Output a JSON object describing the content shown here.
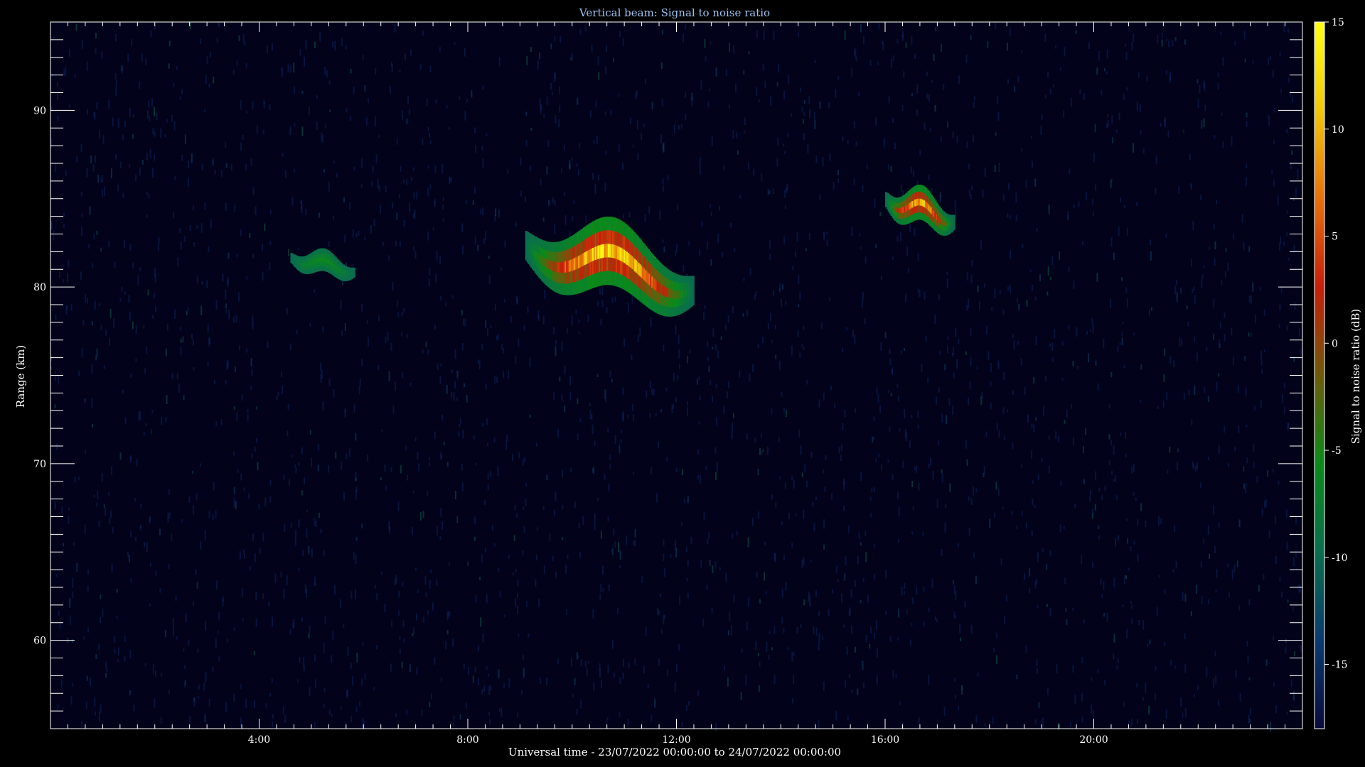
{
  "chart_data": {
    "type": "heatmap",
    "title": "Vertical beam: Signal to noise ratio",
    "xlabel": "Universal time - 23/07/2022 00:00:00 to 24/07/2022 00:00:00",
    "ylabel": "Range (km)",
    "colorbar_label": "Signal to noise ratio (dB)",
    "xlim_hours": [
      0,
      24
    ],
    "ylim_km": [
      55,
      95
    ],
    "x_tick_labels": [
      "4:00",
      "8:00",
      "12:00",
      "16:00",
      "20:00"
    ],
    "x_tick_hours": [
      4,
      8,
      12,
      16,
      20
    ],
    "y_tick_labels": [
      "60",
      "70",
      "80",
      "90"
    ],
    "y_tick_values": [
      60,
      70,
      80,
      90
    ],
    "colorbar_range_db": [
      -18,
      15
    ],
    "colorbar_tick_labels": [
      "15",
      "10",
      "5",
      "0",
      "-5",
      "-10",
      "-15"
    ],
    "colorbar_tick_values": [
      15,
      10,
      5,
      0,
      -5,
      -10,
      -15
    ],
    "colormap": [
      "#0a0a3a",
      "#0a3a6e",
      "#0a6e4e",
      "#0a8a1a",
      "#6e5a0a",
      "#c81e0a",
      "#e8700a",
      "#f0c80a",
      "#ffff14"
    ],
    "background_color": "#02021a",
    "echo_regions": [
      {
        "hour_start": 4.6,
        "hour_end": 5.8,
        "range_top_km": 82.2,
        "range_bottom_km": 80.4,
        "peak_db": -5
      },
      {
        "hour_start": 9.1,
        "hour_end": 12.3,
        "range_top_km": 84.0,
        "range_bottom_km": 78.5,
        "peak_db": 15
      },
      {
        "hour_start": 16.0,
        "hour_end": 17.3,
        "range_top_km": 85.8,
        "range_bottom_km": 83.0,
        "peak_db": 12
      }
    ]
  }
}
